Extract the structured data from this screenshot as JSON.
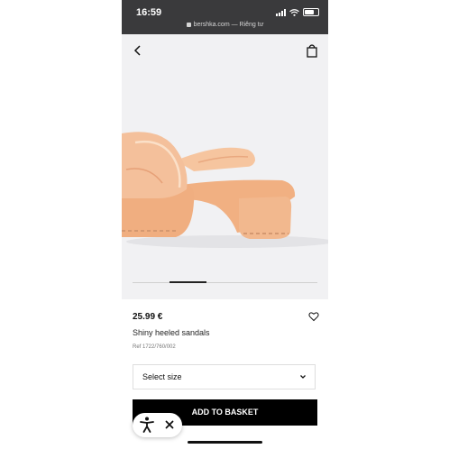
{
  "status_bar": {
    "time": "16:59",
    "url": "bershka.com — Riêng tư",
    "icons": [
      "signal-icon",
      "wifi-icon",
      "battery-icon"
    ]
  },
  "header": {
    "back_icon": "chevron-left-icon",
    "bag_icon": "shopping-bag-icon"
  },
  "gallery": {
    "image": "orange-sandal-photo",
    "progress_fraction": 0.2
  },
  "product": {
    "price": "25.99 €",
    "name": "Shiny heeled sandals",
    "ref": "Ref 1722/760/002"
  },
  "size_select": {
    "label": "Select size"
  },
  "actions": {
    "add_to_basket": "ADD TO BASKET"
  },
  "accessibility_widget": {
    "icon": "accessibility-person-icon",
    "close_icon": "close-icon"
  },
  "colors": {
    "status_bar_bg": "#3a3a3c",
    "image_bg": "#f1f1f3",
    "sandal": "#f2b88e",
    "button_bg": "#000000"
  }
}
